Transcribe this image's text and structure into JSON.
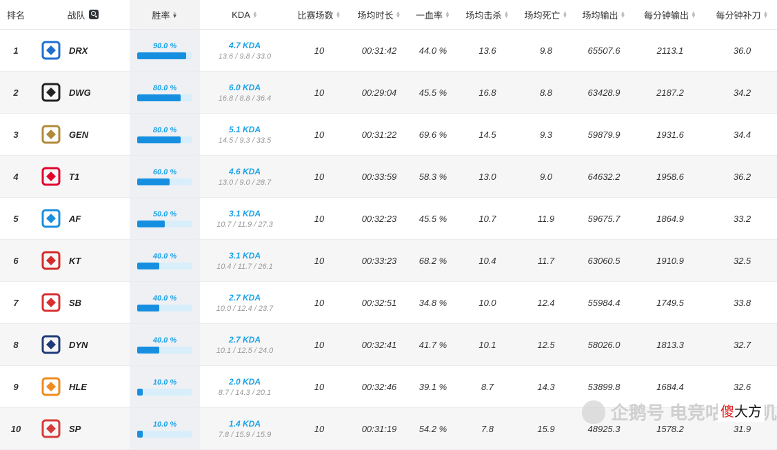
{
  "header": {
    "rank": "排名",
    "team": "战队",
    "winrate": "胜率",
    "kda": "KDA",
    "games": "比赛场数",
    "duration": "场均时长",
    "first_blood": "一血率",
    "kills": "场均击杀",
    "deaths": "场均死亡",
    "damage": "场均输出",
    "dpm": "每分钟输出",
    "cspm": "每分钟补刀"
  },
  "rows": [
    {
      "rank": "1",
      "team": "DRX",
      "winrate": "90.0 %",
      "winrate_value": 90,
      "kda": "4.7 KDA",
      "kda_detail": "13.6 / 9.8 / 33.0",
      "games": "10",
      "duration": "00:31:42",
      "first_blood": "44.0 %",
      "kills": "13.6",
      "deaths": "9.8",
      "damage": "65507.6",
      "dpm": "2113.1",
      "cspm": "36.0",
      "logo_color": "#1e6fd0"
    },
    {
      "rank": "2",
      "team": "DWG",
      "winrate": "80.0 %",
      "winrate_value": 80,
      "kda": "6.0 KDA",
      "kda_detail": "16.8 / 8.8 / 36.4",
      "games": "10",
      "duration": "00:29:04",
      "first_blood": "45.5 %",
      "kills": "16.8",
      "deaths": "8.8",
      "damage": "63428.9",
      "dpm": "2187.2",
      "cspm": "34.2",
      "logo_color": "#222222"
    },
    {
      "rank": "3",
      "team": "GEN",
      "winrate": "80.0 %",
      "winrate_value": 80,
      "kda": "5.1 KDA",
      "kda_detail": "14.5 / 9.3 / 33.5",
      "games": "10",
      "duration": "00:31:22",
      "first_blood": "69.6 %",
      "kills": "14.5",
      "deaths": "9.3",
      "damage": "59879.9",
      "dpm": "1931.6",
      "cspm": "34.4",
      "logo_color": "#b08a3a"
    },
    {
      "rank": "4",
      "team": "T1",
      "winrate": "60.0 %",
      "winrate_value": 60,
      "kda": "4.6 KDA",
      "kda_detail": "13.0 / 9.0 / 28.7",
      "games": "10",
      "duration": "00:33:59",
      "first_blood": "58.3 %",
      "kills": "13.0",
      "deaths": "9.0",
      "damage": "64632.2",
      "dpm": "1958.6",
      "cspm": "36.2",
      "logo_color": "#e2012d"
    },
    {
      "rank": "5",
      "team": "AF",
      "winrate": "50.0 %",
      "winrate_value": 50,
      "kda": "3.1 KDA",
      "kda_detail": "10.7 / 11.9 / 27.3",
      "games": "10",
      "duration": "00:32:23",
      "first_blood": "45.5 %",
      "kills": "10.7",
      "deaths": "11.9",
      "damage": "59675.7",
      "dpm": "1864.9",
      "cspm": "33.2",
      "logo_color": "#1a8fe0"
    },
    {
      "rank": "6",
      "team": "KT",
      "winrate": "40.0 %",
      "winrate_value": 40,
      "kda": "3.1 KDA",
      "kda_detail": "10.4 / 11.7 / 26.1",
      "games": "10",
      "duration": "00:33:23",
      "first_blood": "68.2 %",
      "kills": "10.4",
      "deaths": "11.7",
      "damage": "63060.5",
      "dpm": "1910.9",
      "cspm": "32.5",
      "logo_color": "#d42a2a"
    },
    {
      "rank": "7",
      "team": "SB",
      "winrate": "40.0 %",
      "winrate_value": 40,
      "kda": "2.7 KDA",
      "kda_detail": "10.0 / 12.4 / 23.7",
      "games": "10",
      "duration": "00:32:51",
      "first_blood": "34.8 %",
      "kills": "10.0",
      "deaths": "12.4",
      "damage": "55984.4",
      "dpm": "1749.5",
      "cspm": "33.8",
      "logo_color": "#d83030"
    },
    {
      "rank": "8",
      "team": "DYN",
      "winrate": "40.0 %",
      "winrate_value": 40,
      "kda": "2.7 KDA",
      "kda_detail": "10.1 / 12.5 / 24.0",
      "games": "10",
      "duration": "00:32:41",
      "first_blood": "41.7 %",
      "kills": "10.1",
      "deaths": "12.5",
      "damage": "58026.0",
      "dpm": "1813.3",
      "cspm": "32.7",
      "logo_color": "#1f3a78"
    },
    {
      "rank": "9",
      "team": "HLE",
      "winrate": "10.0 %",
      "winrate_value": 10,
      "kda": "2.0 KDA",
      "kda_detail": "8.7 / 14.3 / 20.1",
      "games": "10",
      "duration": "00:32:46",
      "first_blood": "39.1 %",
      "kills": "8.7",
      "deaths": "14.3",
      "damage": "53899.8",
      "dpm": "1684.4",
      "cspm": "32.6",
      "logo_color": "#f08a1c"
    },
    {
      "rank": "10",
      "team": "SP",
      "winrate": "10.0 %",
      "winrate_value": 10,
      "kda": "1.4 KDA",
      "kda_detail": "7.8 / 15.9 / 15.9",
      "games": "10",
      "duration": "00:31:19",
      "first_blood": "54.2 %",
      "kills": "7.8",
      "deaths": "15.9",
      "damage": "48925.3",
      "dpm": "1578.2",
      "cspm": "31.9",
      "logo_color": "#d83a3a"
    }
  ],
  "watermark": "企鹅号 电竞咕叽咕叽",
  "badge": {
    "left": "傻",
    "right": "大方"
  },
  "colors": {
    "accent": "#1aa3e8",
    "bar": "#168fe0",
    "bar_track": "#d8eefb"
  }
}
